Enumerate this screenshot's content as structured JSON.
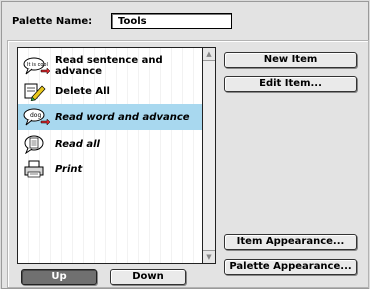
{
  "palette_name_label": "Palette Name:",
  "palette_name_value": "Tools",
  "items": [
    {
      "label": "Read sentence and advance",
      "icon": "speech-sentence-arrow-icon",
      "italic": false,
      "selected": false
    },
    {
      "label": "Delete All",
      "icon": "eraser-pencil-icon",
      "italic": false,
      "selected": false
    },
    {
      "label": "Read word and advance",
      "icon": "speech-word-arrow-icon",
      "italic": true,
      "selected": true
    },
    {
      "label": "Read all",
      "icon": "speech-document-icon",
      "italic": true,
      "selected": false
    },
    {
      "label": "Print",
      "icon": "printer-icon",
      "italic": true,
      "selected": false
    }
  ],
  "buttons": {
    "new_item": "New Item",
    "edit_item": "Edit Item...",
    "item_appearance": "Item Appearance...",
    "palette_appearance": "Palette Appearance...",
    "up": "Up",
    "down": "Down"
  },
  "colors": {
    "selection": "#a8d8ef",
    "up_button": "#707070"
  }
}
